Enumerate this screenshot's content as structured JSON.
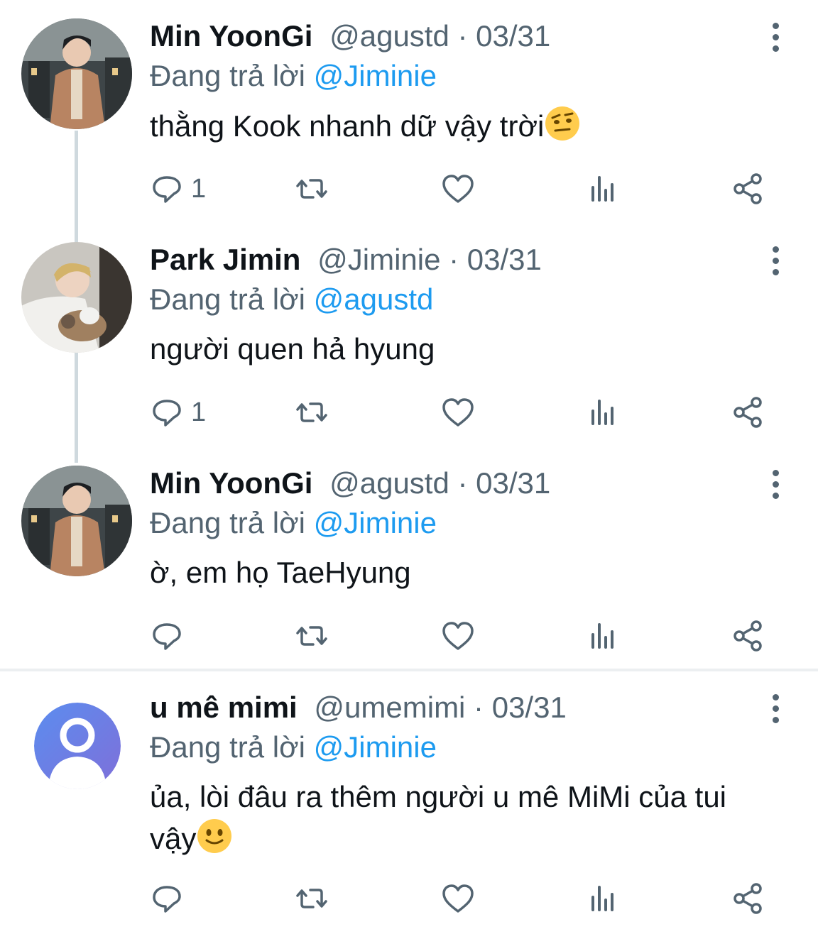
{
  "tweets": [
    {
      "name": "Min YoonGi",
      "handle": "@agustd",
      "sep": " · ",
      "date": "03/31",
      "reply_prefix": "Đang trả lời ",
      "reply_to": "@Jiminie",
      "text": "thằng Kook nhanh dữ vậy trời",
      "emoji": "raised-eyebrow-emoji",
      "reply_count": "1"
    },
    {
      "name": "Park Jimin",
      "handle": "@Jiminie",
      "sep": " · ",
      "date": "03/31",
      "reply_prefix": "Đang trả lời ",
      "reply_to": "@agustd",
      "text": "người quen hả hyung",
      "reply_count": "1"
    },
    {
      "name": "Min YoonGi",
      "handle": "@agustd",
      "sep": " · ",
      "date": "03/31",
      "reply_prefix": "Đang trả lời ",
      "reply_to": "@Jiminie",
      "text": "ờ, em họ TaeHyung",
      "reply_count": ""
    },
    {
      "name": "u mê mimi",
      "handle": "@umemimi",
      "sep": " · ",
      "date": "03/31",
      "reply_prefix": "Đang trả lời ",
      "reply_to": "@Jiminie",
      "text_line1": "ủa, lòi đâu ra thêm người u mê MiMi của tui",
      "text_line2": "vậy",
      "emoji": "slightly-smiling-emoji",
      "reply_count": ""
    }
  ],
  "icons": [
    "reply-icon",
    "retweet-icon",
    "like-icon",
    "analytics-icon",
    "share-icon",
    "more-icon"
  ],
  "colors": {
    "link": "#1d9bf0",
    "muted": "#536471",
    "text": "#0f1419",
    "thread_line": "#cfd9de"
  }
}
